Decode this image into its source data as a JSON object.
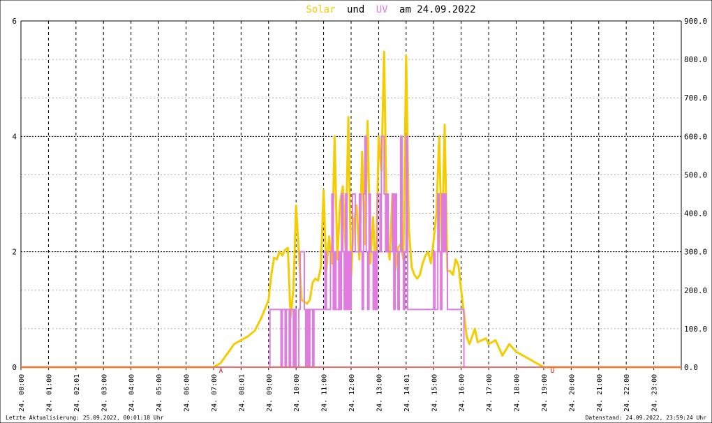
{
  "title": {
    "solar": "Solar",
    "und": "und",
    "uv": "UV",
    "rest": "am 24.09.2022"
  },
  "footer": {
    "left": "Letzte Aktualisierung: 25.09.2022, 00:01:18 Uhr",
    "right": "Datenstand: 24.09.2022, 23:59:24 Uhr"
  },
  "markers": {
    "sunrise": "A",
    "sunset": "U"
  },
  "colors": {
    "solar": "#f5cc00",
    "uv": "#e07be0",
    "baseline": "#ff6666",
    "grid": "#000000"
  },
  "chart_data": {
    "type": "line",
    "title": "Solar und UV am 24.09.2022",
    "grid": true,
    "xlim": [
      0,
      24
    ],
    "y_left": {
      "lim": [
        0,
        6
      ],
      "ticks": [
        "0",
        "2",
        "4",
        "6"
      ]
    },
    "y_right": {
      "lim": [
        0,
        900
      ],
      "ticks": [
        "0.0",
        "100.0",
        "200.0",
        "300.0",
        "400.0",
        "500.0",
        "600.0",
        "700.0",
        "800.0",
        "900.0"
      ]
    },
    "x_tick_labels": [
      "24. 00:00",
      "24. 01:00",
      "24. 02:01",
      "24. 03:00",
      "24. 04:00",
      "24. 05:00",
      "24. 06:00",
      "24. 07:00",
      "24. 08:01",
      "24. 09:00",
      "24. 10:00",
      "24. 11:00",
      "24. 12:00",
      "24. 13:00",
      "24. 14:01",
      "24. 15:00",
      "24. 16:00",
      "24. 17:00",
      "24. 18:00",
      "24. 19:00",
      "24. 20:00",
      "24. 21:00",
      "24. 22:00",
      "24. 23:00"
    ],
    "series": [
      {
        "name": "Solar",
        "axis": "right",
        "x": [
          0,
          7.0,
          7.25,
          7.5,
          7.75,
          8.0,
          8.25,
          8.5,
          8.75,
          9.0,
          9.1,
          9.2,
          9.3,
          9.4,
          9.5,
          9.6,
          9.7,
          9.8,
          9.9,
          10.0,
          10.1,
          10.2,
          10.3,
          10.4,
          10.5,
          10.6,
          10.7,
          10.8,
          10.9,
          11.0,
          11.1,
          11.2,
          11.3,
          11.4,
          11.5,
          11.6,
          11.7,
          11.8,
          11.9,
          12.0,
          12.1,
          12.2,
          12.3,
          12.4,
          12.5,
          12.6,
          12.7,
          12.8,
          12.9,
          13.0,
          13.1,
          13.2,
          13.3,
          13.4,
          13.5,
          13.6,
          13.7,
          13.8,
          13.9,
          14.0,
          14.1,
          14.2,
          14.3,
          14.4,
          14.5,
          14.6,
          14.7,
          14.8,
          14.9,
          15.0,
          15.1,
          15.2,
          15.3,
          15.4,
          15.5,
          15.6,
          15.7,
          15.8,
          15.9,
          16.0,
          16.1,
          16.2,
          16.3,
          16.4,
          16.5,
          16.6,
          16.75,
          16.9,
          17.0,
          17.25,
          17.5,
          17.75,
          18.0,
          18.25,
          18.5,
          18.75,
          19.0,
          24
        ],
        "values": [
          0,
          0,
          10,
          35,
          60,
          70,
          80,
          95,
          130,
          175,
          240,
          285,
          280,
          300,
          290,
          305,
          310,
          130,
          200,
          420,
          300,
          175,
          170,
          165,
          175,
          220,
          230,
          225,
          260,
          460,
          250,
          340,
          270,
          600,
          280,
          430,
          470,
          300,
          650,
          235,
          380,
          420,
          280,
          560,
          320,
          640,
          270,
          390,
          230,
          600,
          510,
          820,
          340,
          280,
          450,
          250,
          310,
          320,
          280,
          810,
          360,
          260,
          240,
          230,
          240,
          270,
          290,
          300,
          270,
          330,
          400,
          600,
          300,
          630,
          250,
          250,
          240,
          280,
          265,
          200,
          140,
          80,
          60,
          80,
          100,
          65,
          70,
          75,
          60,
          70,
          30,
          60,
          40,
          30,
          20,
          10,
          0,
          0
        ]
      },
      {
        "name": "UV",
        "axis": "left",
        "x": [
          0,
          9.0,
          9.05,
          9.4,
          9.45,
          9.5,
          9.55,
          9.6,
          9.65,
          9.7,
          9.75,
          9.8,
          9.85,
          9.9,
          9.95,
          10.0,
          10.1,
          10.15,
          10.3,
          10.35,
          10.4,
          10.45,
          10.5,
          10.55,
          10.6,
          10.65,
          10.7,
          10.8,
          11.0,
          11.05,
          11.1,
          11.2,
          11.25,
          11.3,
          11.35,
          11.4,
          11.45,
          11.5,
          11.55,
          11.6,
          11.65,
          11.7,
          11.75,
          11.8,
          11.85,
          11.9,
          11.95,
          12.0,
          12.05,
          12.1,
          12.15,
          12.3,
          12.35,
          12.4,
          12.45,
          12.5,
          12.55,
          12.6,
          12.65,
          12.7,
          12.75,
          12.8,
          12.85,
          12.9,
          12.95,
          13.0,
          13.05,
          13.1,
          13.2,
          13.25,
          13.3,
          13.35,
          13.45,
          13.5,
          13.55,
          13.6,
          13.65,
          13.7,
          13.75,
          13.8,
          13.85,
          13.9,
          13.95,
          14.0,
          14.05,
          14.1,
          14.15,
          14.2,
          14.95,
          15.0,
          15.05,
          15.1,
          15.15,
          15.2,
          15.25,
          15.3,
          15.35,
          15.4,
          15.45,
          15.5,
          15.6,
          15.65,
          15.7,
          16.05,
          16.1,
          24
        ],
        "values": [
          0,
          0,
          1,
          1,
          0,
          1,
          1,
          0,
          1,
          1,
          0,
          1,
          1,
          0,
          1,
          0,
          1,
          2,
          1,
          0,
          1,
          0,
          1,
          1,
          0,
          1,
          1,
          1,
          1,
          2,
          1,
          1,
          2,
          3,
          1,
          2,
          1,
          1,
          2,
          1,
          3,
          2,
          1,
          3,
          1,
          2,
          1,
          2,
          3,
          3,
          2,
          3,
          2,
          1,
          3,
          4,
          2,
          1,
          3,
          2,
          2,
          1,
          2,
          1,
          3,
          3,
          2,
          4,
          3,
          2,
          3,
          2,
          2,
          3,
          1,
          3,
          2,
          1,
          2,
          4,
          2,
          1,
          2,
          4,
          1,
          1,
          1,
          1,
          1,
          2,
          1,
          1,
          3,
          2,
          1,
          3,
          2,
          3,
          2,
          1,
          1,
          1,
          1,
          1,
          0,
          0
        ]
      }
    ]
  }
}
